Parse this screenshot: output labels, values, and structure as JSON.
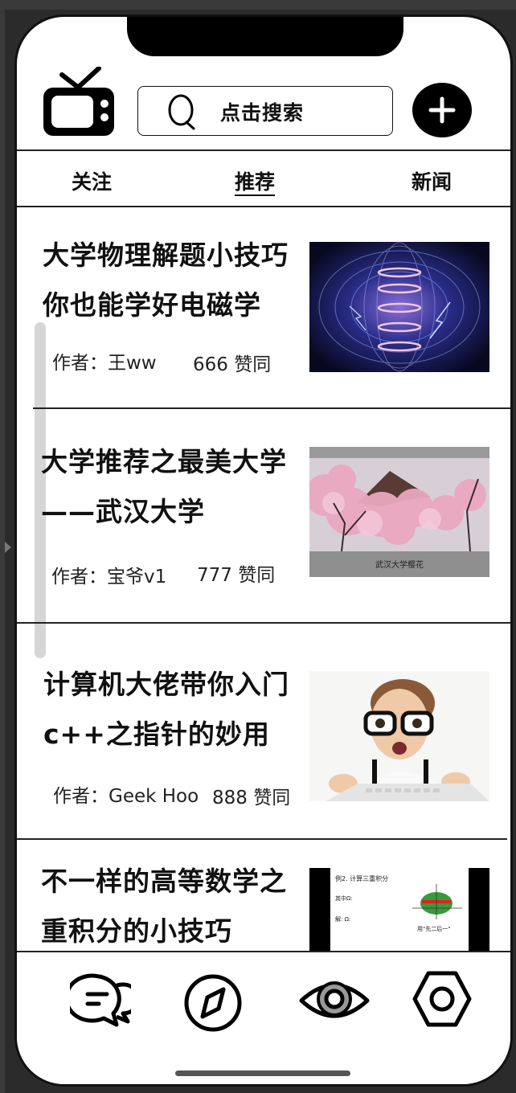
{
  "header": {
    "logo_icon": "tv-icon",
    "search_placeholder": "点击搜索",
    "search_icon": "search-icon",
    "add_icon": "plus-icon"
  },
  "tabs": [
    {
      "label": "关注",
      "active": false
    },
    {
      "label": "推荐",
      "active": true
    },
    {
      "label": "新闻",
      "active": false
    }
  ],
  "feed": [
    {
      "title_line1": "大学物理解题小技巧",
      "title_line2": "你也能学好电磁学",
      "author": "作者：王ww",
      "likes": "666 赞同",
      "thumbnail": "electromagnetic-field-image"
    },
    {
      "title_line1": "大学推荐之最美大学",
      "title_line2": "——武汉大学",
      "author": "作者：宝爷v1",
      "likes": "777 赞同",
      "thumbnail": "cherry-blossom-image",
      "thumbnail_caption": "武汉大学樱花"
    },
    {
      "title_line1": "计算机大佬带你入门",
      "title_line2": "c++之指针的妙用",
      "author": "作者：Geek Hoo",
      "likes": "888 赞同",
      "thumbnail": "programmer-keyboard-image"
    },
    {
      "title_line1": "不一样的高等数学之",
      "title_line2": "重积分的小技巧",
      "thumbnail": "triple-integral-slide-image",
      "thumbnail_text": [
        "例2. 计算三重积分",
        "其中Ω:",
        "解: Ω:",
        "用\"先二后一\""
      ]
    }
  ],
  "bottom_nav": [
    {
      "icon": "chat-icon"
    },
    {
      "icon": "compass-icon"
    },
    {
      "icon": "eye-icon"
    },
    {
      "icon": "settings-hexagon-icon"
    }
  ]
}
